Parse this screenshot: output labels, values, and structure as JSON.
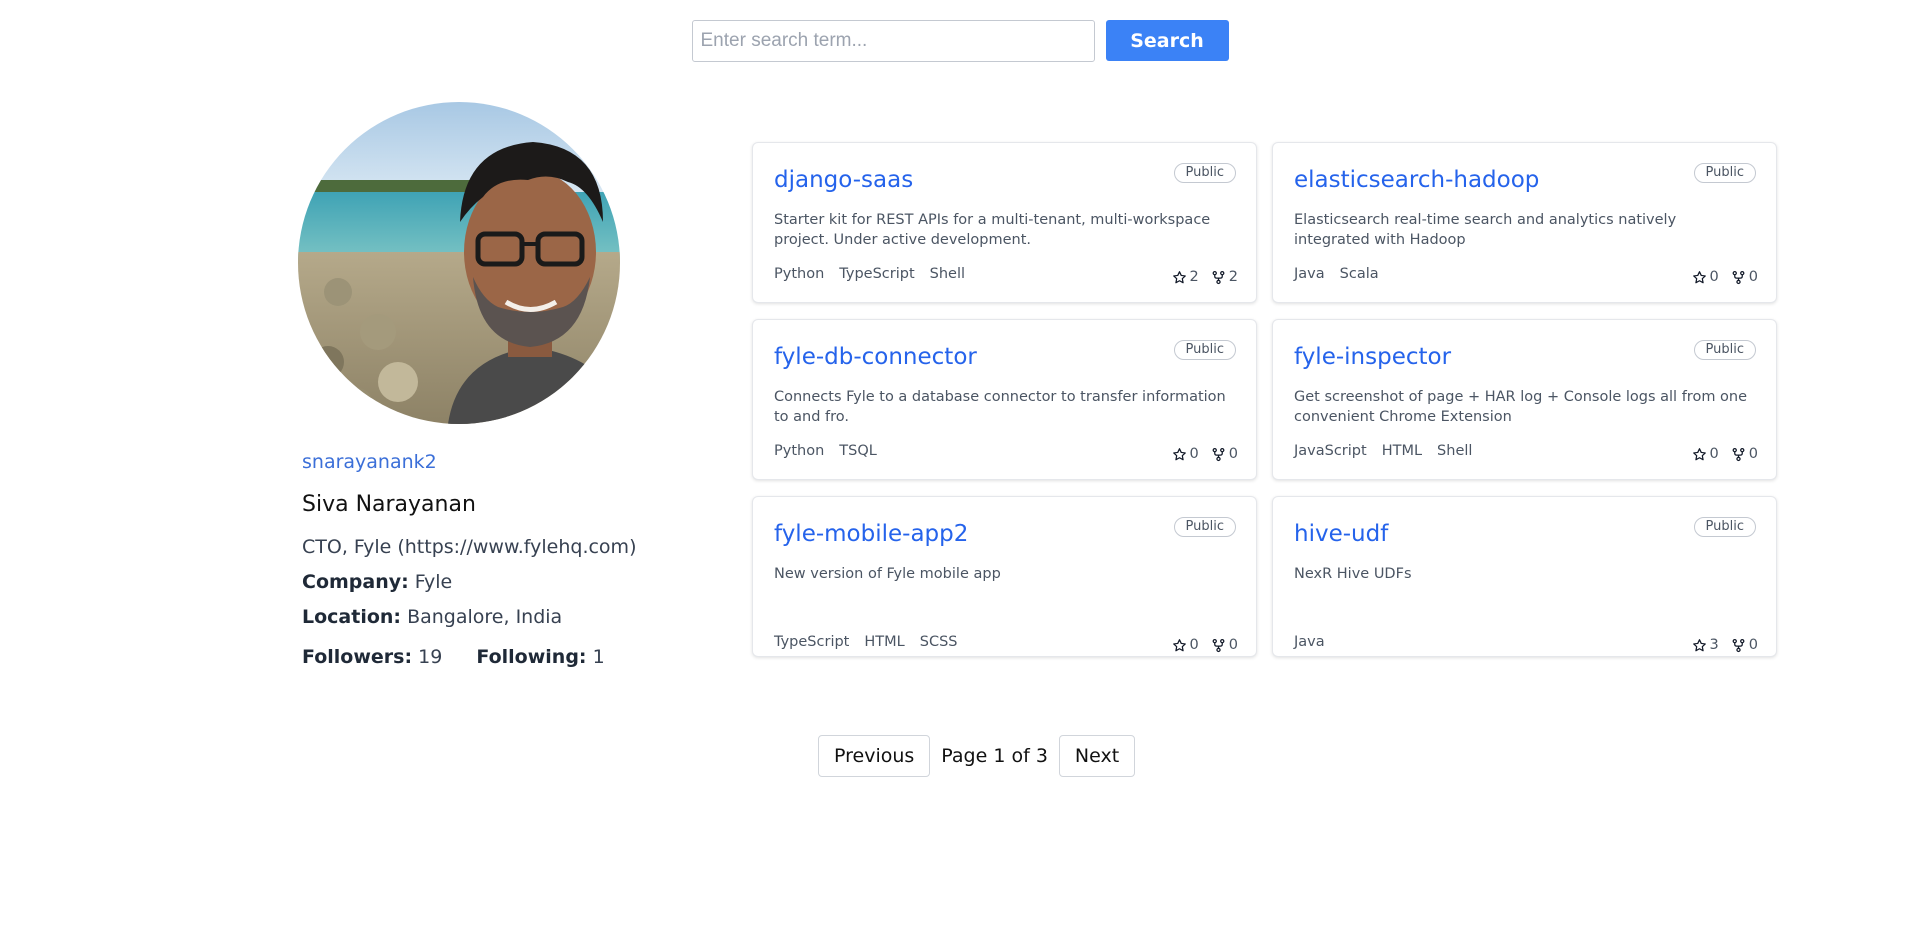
{
  "search": {
    "placeholder": "Enter search term...",
    "value": "",
    "button_label": "Search"
  },
  "profile": {
    "username": "snarayanank2",
    "name": "Siva Narayanan",
    "bio": "CTO, Fyle (https://www.fylehq.com)",
    "company_label": "Company:",
    "company": "Fyle",
    "location_label": "Location:",
    "location": "Bangalore, India",
    "followers_label": "Followers:",
    "followers": "19",
    "following_label": "Following:",
    "following": "1"
  },
  "repos": [
    {
      "name": "django-saas",
      "visibility": "Public",
      "description": "Starter kit for REST APIs for a multi-tenant, multi-workspace project. Under active development.",
      "languages": [
        "Python",
        "TypeScript",
        "Shell"
      ],
      "stars": "2",
      "forks": "2"
    },
    {
      "name": "elasticsearch-hadoop",
      "visibility": "Public",
      "description": "Elasticsearch real-time search and analytics natively integrated with Hadoop",
      "languages": [
        "Java",
        "Scala"
      ],
      "stars": "0",
      "forks": "0"
    },
    {
      "name": "fyle-db-connector",
      "visibility": "Public",
      "description": "Connects Fyle to a database connector to transfer information to and fro.",
      "languages": [
        "Python",
        "TSQL"
      ],
      "stars": "0",
      "forks": "0"
    },
    {
      "name": "fyle-inspector",
      "visibility": "Public",
      "description": "Get screenshot of page + HAR log + Console logs all from one convenient Chrome Extension",
      "languages": [
        "JavaScript",
        "HTML",
        "Shell"
      ],
      "stars": "0",
      "forks": "0"
    },
    {
      "name": "fyle-mobile-app2",
      "visibility": "Public",
      "description": "New version of Fyle mobile app",
      "languages": [
        "TypeScript",
        "HTML",
        "SCSS"
      ],
      "stars": "0",
      "forks": "0"
    },
    {
      "name": "hive-udf",
      "visibility": "Public",
      "description": "NexR Hive UDFs",
      "languages": [
        "Java"
      ],
      "stars": "3",
      "forks": "0"
    }
  ],
  "pagination": {
    "previous_label": "Previous",
    "indicator": "Page 1 of 3",
    "next_label": "Next"
  },
  "colors": {
    "accent": "#3b82f6",
    "link": "#2563eb"
  },
  "icons": {
    "star": "star-icon",
    "fork": "fork-icon"
  }
}
